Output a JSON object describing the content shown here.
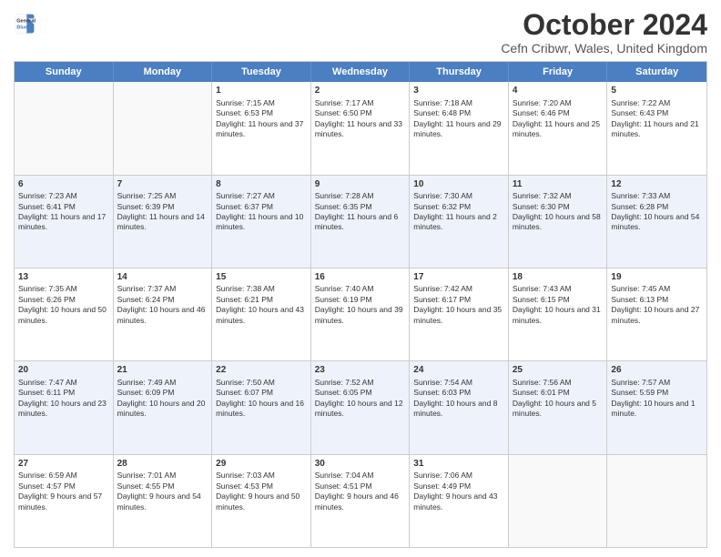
{
  "logo": {
    "line1": "General",
    "line2": "Blue"
  },
  "title": "October 2024",
  "subtitle": "Cefn Cribwr, Wales, United Kingdom",
  "days": [
    "Sunday",
    "Monday",
    "Tuesday",
    "Wednesday",
    "Thursday",
    "Friday",
    "Saturday"
  ],
  "rows": [
    [
      {
        "day": "",
        "sunrise": "",
        "sunset": "",
        "daylight": "",
        "empty": true
      },
      {
        "day": "",
        "sunrise": "",
        "sunset": "",
        "daylight": "",
        "empty": true
      },
      {
        "day": "1",
        "sunrise": "Sunrise: 7:15 AM",
        "sunset": "Sunset: 6:53 PM",
        "daylight": "Daylight: 11 hours and 37 minutes."
      },
      {
        "day": "2",
        "sunrise": "Sunrise: 7:17 AM",
        "sunset": "Sunset: 6:50 PM",
        "daylight": "Daylight: 11 hours and 33 minutes."
      },
      {
        "day": "3",
        "sunrise": "Sunrise: 7:18 AM",
        "sunset": "Sunset: 6:48 PM",
        "daylight": "Daylight: 11 hours and 29 minutes."
      },
      {
        "day": "4",
        "sunrise": "Sunrise: 7:20 AM",
        "sunset": "Sunset: 6:46 PM",
        "daylight": "Daylight: 11 hours and 25 minutes."
      },
      {
        "day": "5",
        "sunrise": "Sunrise: 7:22 AM",
        "sunset": "Sunset: 6:43 PM",
        "daylight": "Daylight: 11 hours and 21 minutes."
      }
    ],
    [
      {
        "day": "6",
        "sunrise": "Sunrise: 7:23 AM",
        "sunset": "Sunset: 6:41 PM",
        "daylight": "Daylight: 11 hours and 17 minutes."
      },
      {
        "day": "7",
        "sunrise": "Sunrise: 7:25 AM",
        "sunset": "Sunset: 6:39 PM",
        "daylight": "Daylight: 11 hours and 14 minutes."
      },
      {
        "day": "8",
        "sunrise": "Sunrise: 7:27 AM",
        "sunset": "Sunset: 6:37 PM",
        "daylight": "Daylight: 11 hours and 10 minutes."
      },
      {
        "day": "9",
        "sunrise": "Sunrise: 7:28 AM",
        "sunset": "Sunset: 6:35 PM",
        "daylight": "Daylight: 11 hours and 6 minutes."
      },
      {
        "day": "10",
        "sunrise": "Sunrise: 7:30 AM",
        "sunset": "Sunset: 6:32 PM",
        "daylight": "Daylight: 11 hours and 2 minutes."
      },
      {
        "day": "11",
        "sunrise": "Sunrise: 7:32 AM",
        "sunset": "Sunset: 6:30 PM",
        "daylight": "Daylight: 10 hours and 58 minutes."
      },
      {
        "day": "12",
        "sunrise": "Sunrise: 7:33 AM",
        "sunset": "Sunset: 6:28 PM",
        "daylight": "Daylight: 10 hours and 54 minutes."
      }
    ],
    [
      {
        "day": "13",
        "sunrise": "Sunrise: 7:35 AM",
        "sunset": "Sunset: 6:26 PM",
        "daylight": "Daylight: 10 hours and 50 minutes."
      },
      {
        "day": "14",
        "sunrise": "Sunrise: 7:37 AM",
        "sunset": "Sunset: 6:24 PM",
        "daylight": "Daylight: 10 hours and 46 minutes."
      },
      {
        "day": "15",
        "sunrise": "Sunrise: 7:38 AM",
        "sunset": "Sunset: 6:21 PM",
        "daylight": "Daylight: 10 hours and 43 minutes."
      },
      {
        "day": "16",
        "sunrise": "Sunrise: 7:40 AM",
        "sunset": "Sunset: 6:19 PM",
        "daylight": "Daylight: 10 hours and 39 minutes."
      },
      {
        "day": "17",
        "sunrise": "Sunrise: 7:42 AM",
        "sunset": "Sunset: 6:17 PM",
        "daylight": "Daylight: 10 hours and 35 minutes."
      },
      {
        "day": "18",
        "sunrise": "Sunrise: 7:43 AM",
        "sunset": "Sunset: 6:15 PM",
        "daylight": "Daylight: 10 hours and 31 minutes."
      },
      {
        "day": "19",
        "sunrise": "Sunrise: 7:45 AM",
        "sunset": "Sunset: 6:13 PM",
        "daylight": "Daylight: 10 hours and 27 minutes."
      }
    ],
    [
      {
        "day": "20",
        "sunrise": "Sunrise: 7:47 AM",
        "sunset": "Sunset: 6:11 PM",
        "daylight": "Daylight: 10 hours and 23 minutes."
      },
      {
        "day": "21",
        "sunrise": "Sunrise: 7:49 AM",
        "sunset": "Sunset: 6:09 PM",
        "daylight": "Daylight: 10 hours and 20 minutes."
      },
      {
        "day": "22",
        "sunrise": "Sunrise: 7:50 AM",
        "sunset": "Sunset: 6:07 PM",
        "daylight": "Daylight: 10 hours and 16 minutes."
      },
      {
        "day": "23",
        "sunrise": "Sunrise: 7:52 AM",
        "sunset": "Sunset: 6:05 PM",
        "daylight": "Daylight: 10 hours and 12 minutes."
      },
      {
        "day": "24",
        "sunrise": "Sunrise: 7:54 AM",
        "sunset": "Sunset: 6:03 PM",
        "daylight": "Daylight: 10 hours and 8 minutes."
      },
      {
        "day": "25",
        "sunrise": "Sunrise: 7:56 AM",
        "sunset": "Sunset: 6:01 PM",
        "daylight": "Daylight: 10 hours and 5 minutes."
      },
      {
        "day": "26",
        "sunrise": "Sunrise: 7:57 AM",
        "sunset": "Sunset: 5:59 PM",
        "daylight": "Daylight: 10 hours and 1 minute."
      }
    ],
    [
      {
        "day": "27",
        "sunrise": "Sunrise: 6:59 AM",
        "sunset": "Sunset: 4:57 PM",
        "daylight": "Daylight: 9 hours and 57 minutes."
      },
      {
        "day": "28",
        "sunrise": "Sunrise: 7:01 AM",
        "sunset": "Sunset: 4:55 PM",
        "daylight": "Daylight: 9 hours and 54 minutes."
      },
      {
        "day": "29",
        "sunrise": "Sunrise: 7:03 AM",
        "sunset": "Sunset: 4:53 PM",
        "daylight": "Daylight: 9 hours and 50 minutes."
      },
      {
        "day": "30",
        "sunrise": "Sunrise: 7:04 AM",
        "sunset": "Sunset: 4:51 PM",
        "daylight": "Daylight: 9 hours and 46 minutes."
      },
      {
        "day": "31",
        "sunrise": "Sunrise: 7:06 AM",
        "sunset": "Sunset: 4:49 PM",
        "daylight": "Daylight: 9 hours and 43 minutes."
      },
      {
        "day": "",
        "sunrise": "",
        "sunset": "",
        "daylight": "",
        "empty": true
      },
      {
        "day": "",
        "sunrise": "",
        "sunset": "",
        "daylight": "",
        "empty": true
      }
    ]
  ]
}
